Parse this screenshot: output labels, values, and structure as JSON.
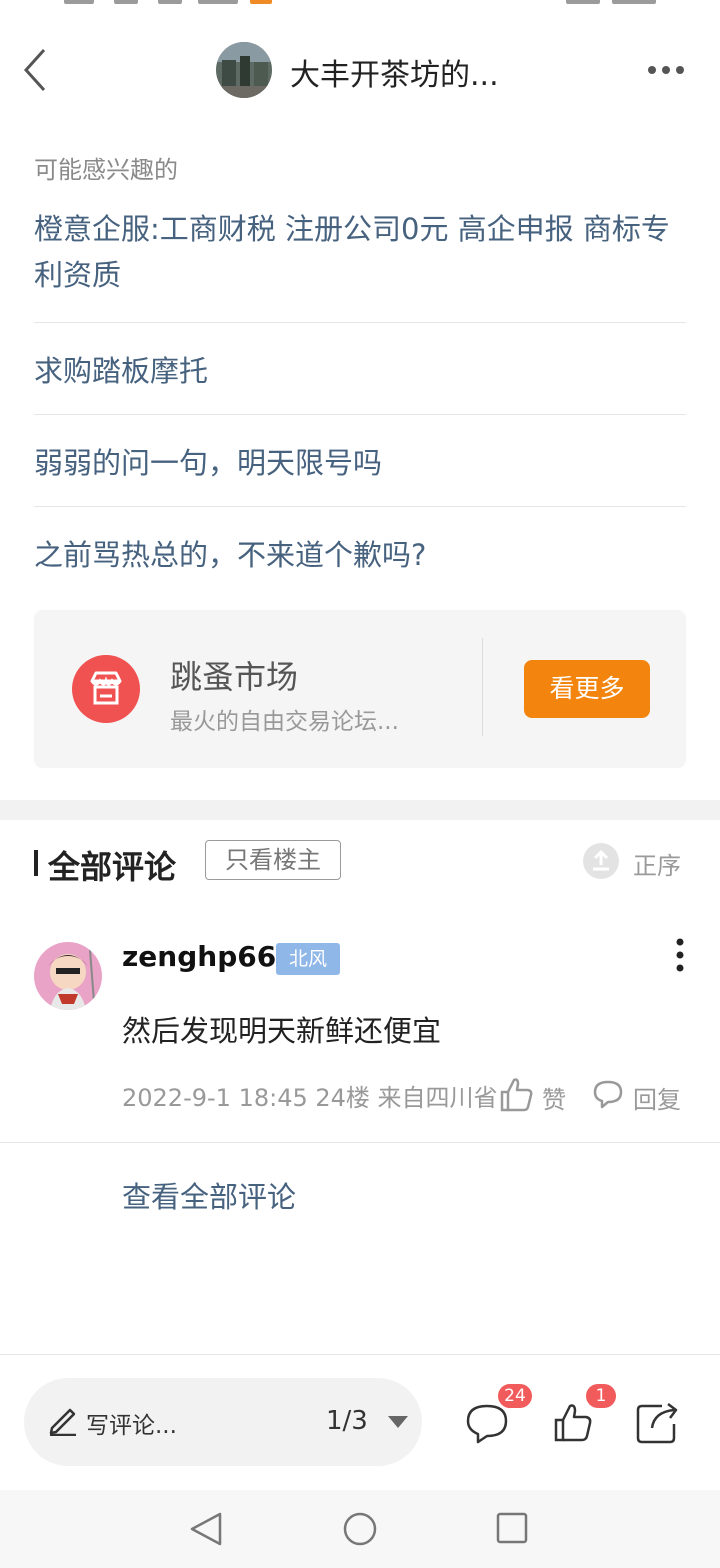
{
  "header": {
    "title": "大丰开茶坊的..."
  },
  "interests": {
    "label": "可能感兴趣的",
    "items": [
      "橙意企服:工商财税 注册公司0元 高企申报 商标专利资质",
      "求购踏板摩托",
      "弱弱的问一句，明天限号吗",
      "之前骂热总的，不来道个歉吗?"
    ]
  },
  "flea_market": {
    "title": "跳蚤市场",
    "subtitle": "最火的自由交易论坛...",
    "button": "看更多"
  },
  "comments": {
    "title": "全部评论",
    "op_only": "只看楼主",
    "sort": "正序",
    "items": [
      {
        "username": "zenghp66",
        "badge": "北风",
        "text": "然后发现明天新鲜还便宜",
        "meta": "2022-9-1 18:45  24楼  来自四川省",
        "like_label": "赞",
        "reply_label": "回复"
      }
    ],
    "view_all": "查看全部评论"
  },
  "bottom_bar": {
    "write_placeholder": "写评论...",
    "page": "1/3",
    "comment_count": "24",
    "like_count": "1"
  },
  "icons": [
    "back-icon",
    "more-icon",
    "shop-icon",
    "sort-icon",
    "like-icon",
    "reply-icon",
    "pencil-icon",
    "comment-icon",
    "share-icon"
  ],
  "colors": {
    "link": "#47627f",
    "accent_orange": "#f3850e",
    "shop_red": "#f05151",
    "badge_blue": "#8fb7e8",
    "count_red": "#f25b5b"
  }
}
